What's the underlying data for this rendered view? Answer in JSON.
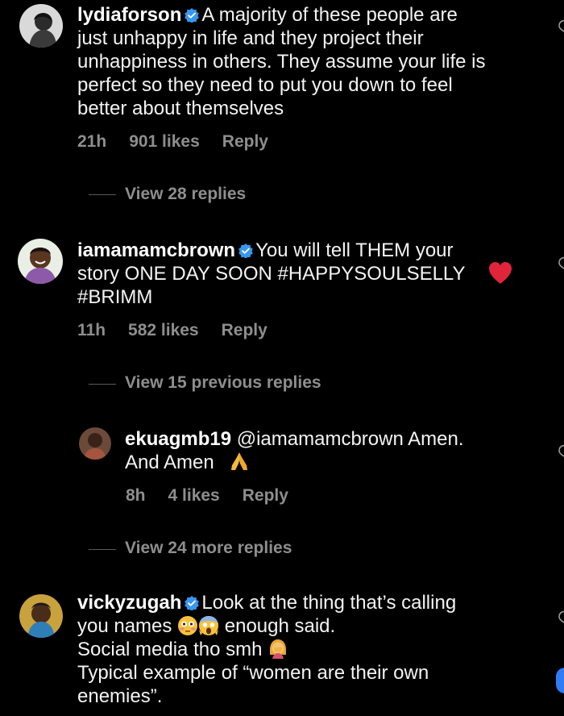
{
  "comments": [
    {
      "username": "lydiaforson",
      "text": "A majority of these people are\njust unhappy in life and they project their\nunhappiness in others. They assume your life is\nperfect so they need to put you down to feel\nbetter about themselves",
      "time": "21h",
      "likes": "901 likes",
      "reply": "Reply",
      "view_link": "View 28 replies"
    },
    {
      "username": "iamamamcbrown",
      "text": "You will tell THEM your\nstory ONE DAY SOON #HAPPYSOULSELLY\n#BRIMM",
      "time": "11h",
      "likes": "582 likes",
      "reply": "Reply",
      "view_link": "View 15 previous replies"
    },
    {
      "username": "ekuagmb19",
      "text": "@iamamamcbrown Amen.\nAnd Amen",
      "time": "8h",
      "likes": "4 likes",
      "reply": "Reply",
      "view_link": "View 24 more replies"
    },
    {
      "username": "vickyzugah",
      "text_line1": "Look at the thing that’s calling",
      "text_line2a": "you names",
      "text_line2b": "enough said.",
      "text_line3": "Social media tho smh",
      "text_line4": "Typical example of “women are their own\nenemies”."
    }
  ],
  "colors": {
    "background": "#000000",
    "text": "#f3f3f3",
    "meta": "#8e8e8e",
    "verified": "#3897f0",
    "heart": "#ed4956"
  },
  "icons": {
    "verified": "verified-badge-icon",
    "like": "heart-outline-icon",
    "emoji_heart": "red-heart-emoji",
    "emoji_pray": "folded-hands-emoji",
    "emoji_flushed": "flushed-face-emoji",
    "emoji_scream": "screaming-face-emoji",
    "emoji_facepalm": "woman-facepalming-emoji"
  }
}
